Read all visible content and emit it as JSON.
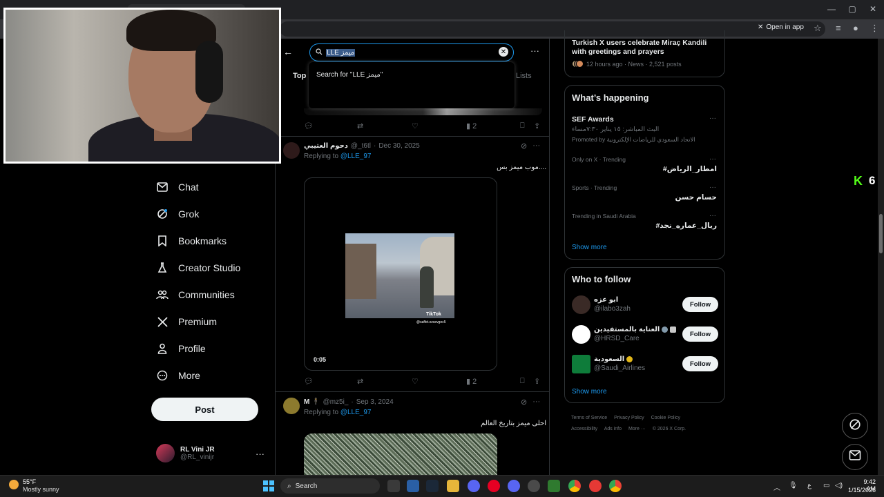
{
  "browser": {
    "open_in_app": "Open in app"
  },
  "nav": {
    "items": [
      {
        "label": "Chat",
        "icon": "mail-icon"
      },
      {
        "label": "Grok",
        "icon": "grok-icon"
      },
      {
        "label": "Bookmarks",
        "icon": "bookmark-icon"
      },
      {
        "label": "Creator Studio",
        "icon": "flask-icon"
      },
      {
        "label": "Communities",
        "icon": "people-icon"
      },
      {
        "label": "Premium",
        "icon": "x-logo-icon"
      },
      {
        "label": "Profile",
        "icon": "person-icon"
      },
      {
        "label": "More",
        "icon": "more-circle-icon"
      }
    ],
    "post_label": "Post",
    "account_name": "RL Vini JR",
    "account_handle": "@RL_vinijr"
  },
  "search": {
    "query": "LLE ميمز",
    "suggestion": "Search for \"LLE ميمز\"",
    "tab_top": "Top",
    "tab_lists": "Lists"
  },
  "tweets": [
    {
      "actions": {
        "views": "2"
      }
    },
    {
      "name": "دحوم العتيبي",
      "handle": "@_t6tl",
      "date": "Dec 30, 2025",
      "replying_prefix": "Replying to",
      "replying_to": "@LLE_97",
      "text": "موب ميمز بس....",
      "video_duration": "0:05",
      "tiktok_label": "TikTok",
      "tiktok_user": "@saffet.ozsevgec5",
      "actions": {
        "views": "2"
      }
    },
    {
      "name": "M 🕴",
      "handle": "@mz5i_",
      "date": "Sep 3, 2024",
      "replying_prefix": "Replying to",
      "replying_to": "@LLE_97",
      "text": "احلى ميمز بتاريخ العالم"
    }
  ],
  "right": {
    "news": {
      "title": "Turkish X users celebrate Miraç Kandili with greetings and prayers",
      "meta": "12 hours ago · News · 2,521 posts"
    },
    "whats_happening": {
      "heading": "What’s happening",
      "promo_title": "SEF Awards",
      "promo_sub": "البث المباشر: ١٥ يناير ٧:٣٠مساء",
      "promo_by": "Promoted by الاتحاد السعودي للرياضات الإلكترونية",
      "trends": [
        {
          "context": "Only on X · Trending",
          "title": "#امطار_الرياض"
        },
        {
          "context": "Sports · Trending",
          "title": "حسام حسن"
        },
        {
          "context": "Trending in Saudi Arabia",
          "title": "#ريال_عماره_نجد"
        }
      ],
      "show_more": "Show more"
    },
    "who_to_follow": {
      "heading": "Who to follow",
      "accounts": [
        {
          "name": "ابو عزه",
          "handle": "@ilabo3zah",
          "follow": "Follow"
        },
        {
          "name": "العناية بالمستفيدين",
          "handle": "@HRSD_Care",
          "follow": "Follow"
        },
        {
          "name": "السعودية",
          "handle": "@Saudi_Airlines",
          "follow": "Follow"
        }
      ],
      "show_more": "Show more"
    },
    "footer": [
      "Terms of Service",
      "Privacy Policy",
      "Cookie Policy",
      "Accessibility",
      "Ads info",
      "More ···",
      "© 2026 X Corp."
    ]
  },
  "overlay": {
    "k_letter": "K",
    "count": "6"
  },
  "taskbar": {
    "temperature": "55°F",
    "weather": "Mostly sunny",
    "search_label": "Search",
    "time": "9:42 AM",
    "date": "1/15/2026",
    "lang": "ع"
  },
  "colors": {
    "accent": "#1d9bf0",
    "background": "#000000",
    "kick_green": "#53fc18"
  }
}
